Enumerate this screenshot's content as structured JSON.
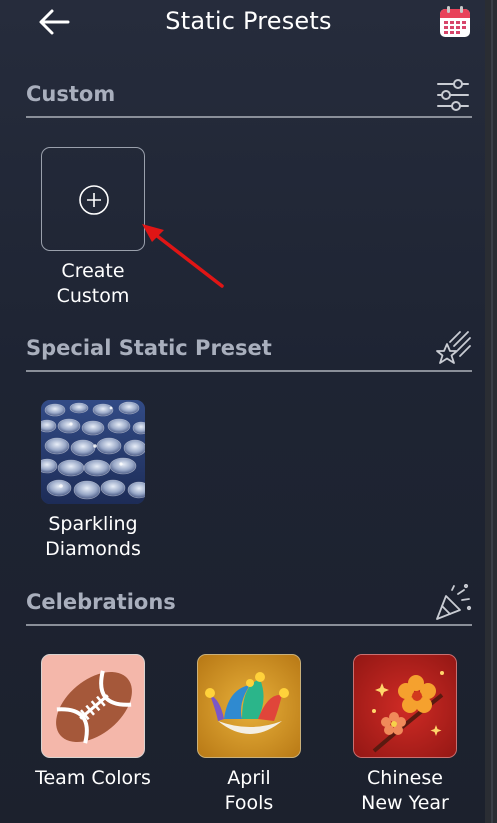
{
  "header": {
    "title": "Static Presets",
    "back_icon": "back-arrow-icon",
    "calendar_icon": "calendar-icon"
  },
  "sections": {
    "custom": {
      "title": "Custom",
      "icon": "sliders-icon"
    },
    "special": {
      "title": "Special Static Preset",
      "icon": "shooting-star-icon"
    },
    "celebrations": {
      "title": "Celebrations",
      "icon": "party-popper-icon"
    }
  },
  "custom_tile": {
    "line1": "Create",
    "line2": "Custom",
    "icon": "plus-circle-icon"
  },
  "special_tile": {
    "line1": "Sparkling",
    "line2": "Diamonds"
  },
  "celebration_tiles": [
    {
      "line1": "Team Colors",
      "line2": "",
      "icon": "football-icon",
      "bg": "#f4b7aa"
    },
    {
      "line1": "April",
      "line2": "Fools",
      "icon": "jester-hat-icon",
      "bg": "#d79a2a"
    },
    {
      "line1": "Chinese",
      "line2": "New Year",
      "icon": "plum-blossom-icon",
      "bg": "#b8231f"
    }
  ],
  "colors": {
    "background": "#1e2433",
    "section_text": "#a9afbd",
    "annotation_arrow": "#e01515"
  }
}
